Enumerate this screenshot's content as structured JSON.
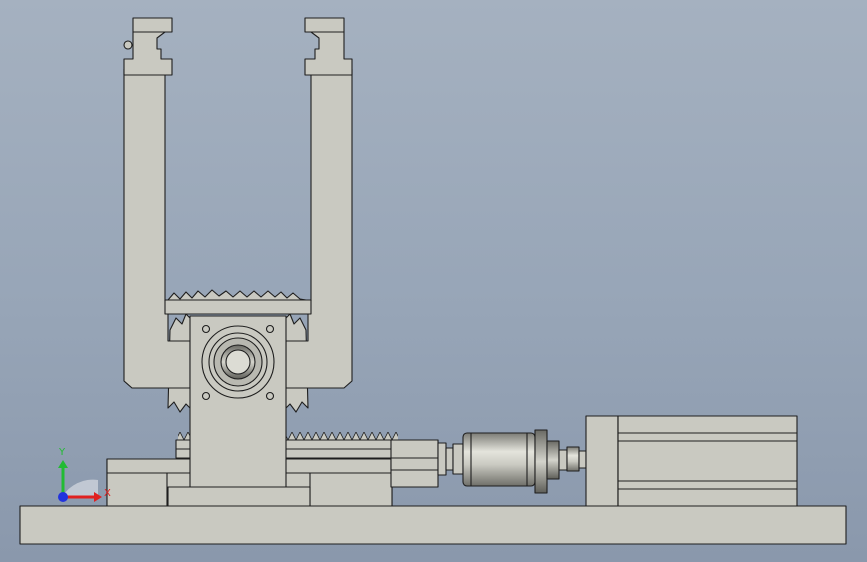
{
  "view": {
    "background_top": "#a5b1c0",
    "background_bottom": "#8a98ac",
    "part_fill": "#c9c9c1",
    "part_stroke": "#1e1e1e"
  },
  "triad": {
    "x_label": "X",
    "y_label": "Y",
    "x_color": "#e02020",
    "y_color": "#22bb33",
    "z_color": "#2233dd"
  }
}
